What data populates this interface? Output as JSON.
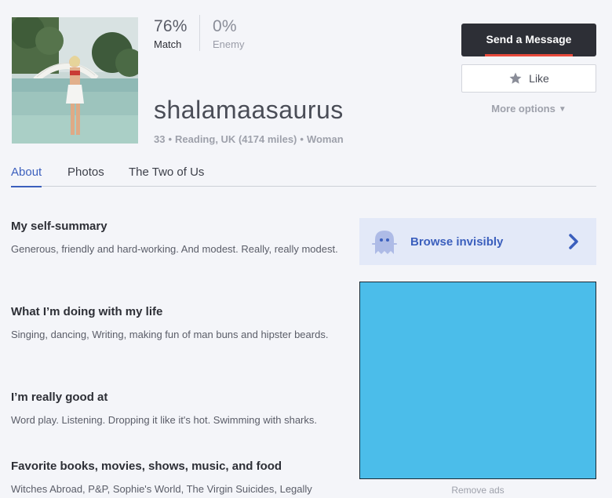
{
  "profile": {
    "username": "shalamaasaurus",
    "age": "33",
    "location": "Reading, UK",
    "distance": "(4174 miles)",
    "gender": "Woman",
    "photo_icon": "profile-photo"
  },
  "stats": {
    "match_pct": "76%",
    "match_label": "Match",
    "enemy_pct": "0%",
    "enemy_label": "Enemy"
  },
  "actions": {
    "send_message": "Send a Message",
    "like": "Like",
    "like_icon": "star-icon",
    "more_options": "More options",
    "more_icon": "chevron-down-icon"
  },
  "tabs": [
    {
      "label": "About",
      "active": true
    },
    {
      "label": "Photos",
      "active": false
    },
    {
      "label": "The Two of Us",
      "active": false
    }
  ],
  "essays": [
    {
      "title": "My self-summary",
      "body": "Generous, friendly and hard-working. And modest. Really, really modest."
    },
    {
      "title": "What I’m doing with my life",
      "body": "Singing, dancing, Writing, making fun of man buns and hipster beards."
    },
    {
      "title": "I’m really good at",
      "body": "Word play. Listening. Dropping it like it's hot. Swimming with sharks."
    },
    {
      "title": "Favorite books, movies, shows, music, and food",
      "body": "Witches Abroad, P&P, Sophie's World, The Virgin Suicides, Legally"
    }
  ],
  "sidebar": {
    "browse_label": "Browse invisibly",
    "browse_icon": "ghost-icon",
    "browse_arrow_icon": "chevron-right-icon",
    "remove_ads": "Remove ads"
  },
  "colors": {
    "accent_blue": "#3b5fbd",
    "message_button": "#2d2f36",
    "message_underline": "#e84a3c",
    "ad_placeholder": "#4bbdea"
  }
}
